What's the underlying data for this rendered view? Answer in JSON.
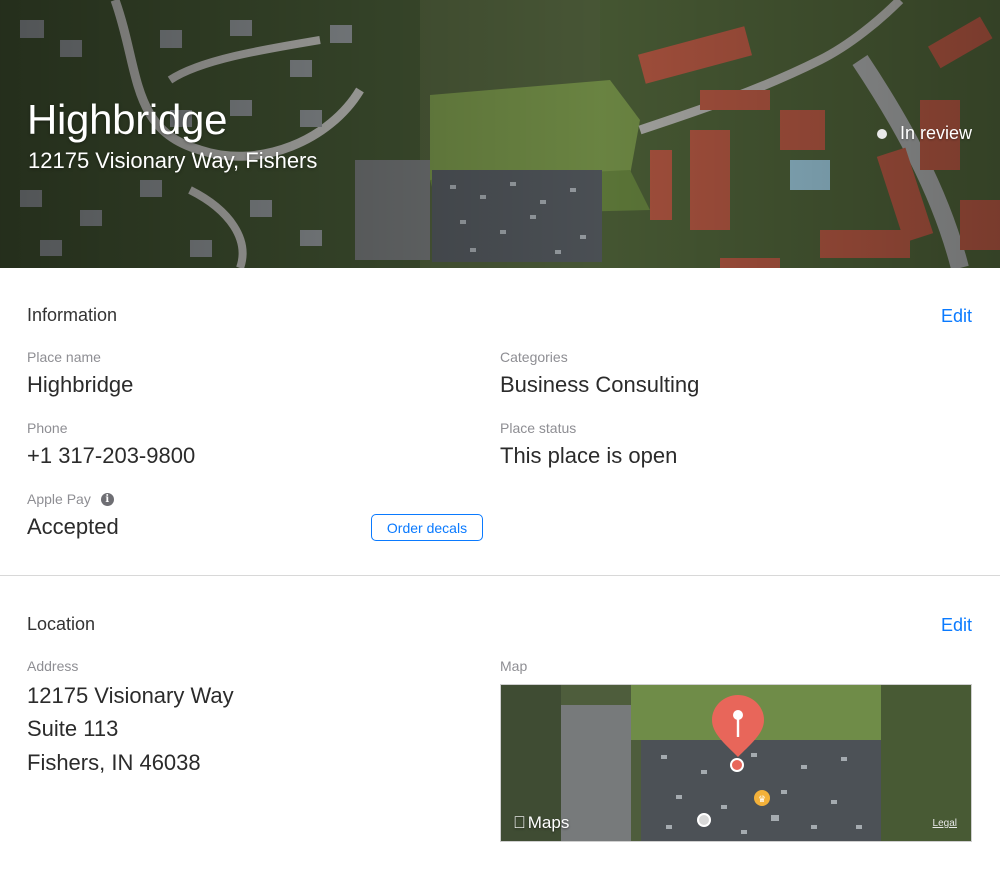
{
  "header": {
    "title": "Highbridge",
    "subtitle": "12175 Visionary Way, Fishers",
    "status": "In review"
  },
  "information": {
    "title": "Information",
    "edit_label": "Edit",
    "place_name": {
      "label": "Place name",
      "value": "Highbridge"
    },
    "categories": {
      "label": "Categories",
      "value": "Business Consulting"
    },
    "phone": {
      "label": "Phone",
      "value": "+1 317-203-9800"
    },
    "place_status": {
      "label": "Place status",
      "value": "This place is open"
    },
    "apple_pay": {
      "label": "Apple Pay",
      "value": "Accepted",
      "info_icon": "info-icon"
    },
    "order_decals_label": "Order decals"
  },
  "location": {
    "title": "Location",
    "edit_label": "Edit",
    "address_label": "Address",
    "address_lines": [
      "12175 Visionary Way",
      "Suite 113",
      "Fishers, IN 46038"
    ],
    "map_label": "Map",
    "map_brand": "Maps",
    "map_legal": "Legal"
  },
  "colors": {
    "accent": "#0a7aff",
    "pin": "#e8665a",
    "label_gray": "#8e8e93"
  }
}
